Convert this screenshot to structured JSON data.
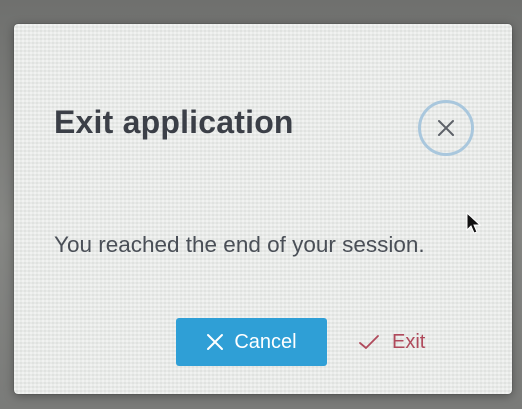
{
  "dialog": {
    "title": "Exit application",
    "message": "You reached the end of your session.",
    "close_icon": "close-icon",
    "cancel_label": "Cancel",
    "cancel_icon": "close-icon",
    "exit_label": "Exit",
    "exit_icon": "check-icon"
  },
  "colors": {
    "primary": "#2f9fd6",
    "exit_text": "#b04a5c",
    "title_text": "#3b3f47",
    "close_ring": "#a9c7dd"
  }
}
